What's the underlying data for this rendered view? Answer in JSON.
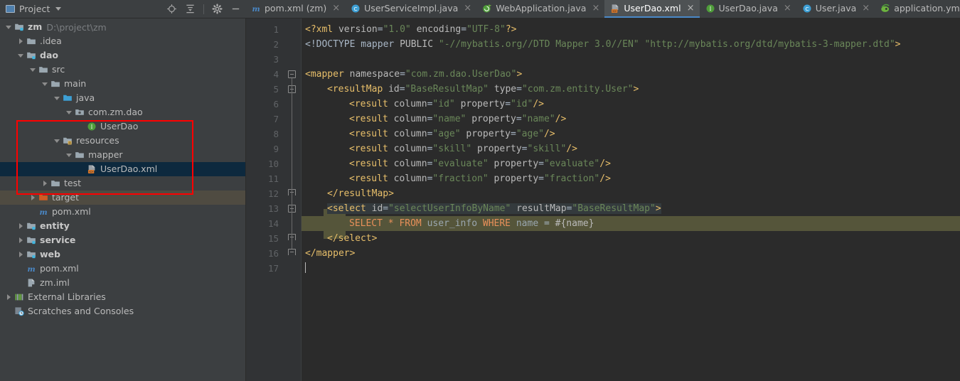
{
  "toolwindow": {
    "title": "Project",
    "dropdown_icon": "chevron-down-icon",
    "actions": [
      {
        "name": "locate-icon",
        "tooltip": "Select Opened File"
      },
      {
        "name": "collapse-all-icon",
        "tooltip": "Collapse All"
      },
      {
        "name": "gear-icon",
        "tooltip": "Settings"
      },
      {
        "name": "minimize-icon",
        "tooltip": "Hide"
      }
    ]
  },
  "tabs": [
    {
      "label": "pom.xml (zm)",
      "icon": "maven-icon",
      "active": false,
      "close": "×"
    },
    {
      "label": "UserServiceImpl.java",
      "icon": "java-class-icon",
      "active": false,
      "close": "×"
    },
    {
      "label": "WebApplication.java",
      "icon": "spring-boot-icon",
      "active": false,
      "close": "×"
    },
    {
      "label": "UserDao.xml",
      "icon": "mybatis-mapper-icon",
      "active": true,
      "close": "×"
    },
    {
      "label": "UserDao.java",
      "icon": "java-interface-icon",
      "active": false,
      "close": "×"
    },
    {
      "label": "User.java",
      "icon": "java-class-icon",
      "active": false,
      "close": "×"
    },
    {
      "label": "application.yml",
      "icon": "yaml-icon",
      "active": false,
      "close": "×"
    }
  ],
  "tree": [
    {
      "indent": 0,
      "arrow": "open",
      "icon": "module-folder-icon",
      "label": "zm",
      "bold": true,
      "path": "D:\\project\\zm",
      "state": "normal"
    },
    {
      "indent": 1,
      "arrow": "closed",
      "icon": "folder-icon",
      "label": ".idea",
      "bold": false,
      "path": "",
      "state": "normal"
    },
    {
      "indent": 1,
      "arrow": "open",
      "icon": "module-folder-icon",
      "label": "dao",
      "bold": true,
      "path": "",
      "state": "normal"
    },
    {
      "indent": 2,
      "arrow": "open",
      "icon": "folder-icon",
      "label": "src",
      "bold": false,
      "path": "",
      "state": "normal"
    },
    {
      "indent": 3,
      "arrow": "open",
      "icon": "folder-icon",
      "label": "main",
      "bold": false,
      "path": "",
      "state": "normal"
    },
    {
      "indent": 4,
      "arrow": "open",
      "icon": "source-root-icon",
      "label": "java",
      "bold": false,
      "path": "",
      "state": "normal"
    },
    {
      "indent": 5,
      "arrow": "open",
      "icon": "package-icon",
      "label": "com.zm.dao",
      "bold": false,
      "path": "",
      "state": "normal"
    },
    {
      "indent": 6,
      "arrow": "none",
      "icon": "interface-icon",
      "label": "UserDao",
      "bold": false,
      "path": "",
      "state": "normal"
    },
    {
      "indent": 4,
      "arrow": "open",
      "icon": "resources-root-icon",
      "label": "resources",
      "bold": false,
      "path": "",
      "state": "normal"
    },
    {
      "indent": 5,
      "arrow": "open",
      "icon": "folder-icon",
      "label": "mapper",
      "bold": false,
      "path": "",
      "state": "normal"
    },
    {
      "indent": 6,
      "arrow": "none",
      "icon": "mybatis-mapper-icon",
      "label": "UserDao.xml",
      "bold": false,
      "path": "",
      "state": "selected"
    },
    {
      "indent": 3,
      "arrow": "closed",
      "icon": "folder-icon",
      "label": "test",
      "bold": false,
      "path": "",
      "state": "normal"
    },
    {
      "indent": 2,
      "arrow": "closed",
      "icon": "excluded-folder-icon",
      "label": "target",
      "bold": false,
      "path": "",
      "state": "excluded"
    },
    {
      "indent": 2,
      "arrow": "none",
      "icon": "maven-icon",
      "label": "pom.xml",
      "bold": false,
      "path": "",
      "state": "normal"
    },
    {
      "indent": 1,
      "arrow": "closed",
      "icon": "module-folder-icon",
      "label": "entity",
      "bold": true,
      "path": "",
      "state": "normal"
    },
    {
      "indent": 1,
      "arrow": "closed",
      "icon": "module-folder-icon",
      "label": "service",
      "bold": true,
      "path": "",
      "state": "normal"
    },
    {
      "indent": 1,
      "arrow": "closed",
      "icon": "module-folder-icon",
      "label": "web",
      "bold": true,
      "path": "",
      "state": "normal"
    },
    {
      "indent": 1,
      "arrow": "none",
      "icon": "maven-icon",
      "label": "pom.xml",
      "bold": false,
      "path": "",
      "state": "normal"
    },
    {
      "indent": 1,
      "arrow": "none",
      "icon": "iml-icon",
      "label": "zm.iml",
      "bold": false,
      "path": "",
      "state": "normal"
    },
    {
      "indent": 0,
      "arrow": "closed",
      "icon": "libraries-icon",
      "label": "External Libraries",
      "bold": false,
      "path": "",
      "state": "normal"
    },
    {
      "indent": 0,
      "arrow": "none",
      "icon": "scratches-icon",
      "label": "Scratches and Consoles",
      "bold": false,
      "path": "",
      "state": "normal"
    }
  ],
  "annotation": {
    "shape": "rectangle",
    "color": "#ff0000",
    "covers": "com.zm.dao / UserDao / resources / mapper / UserDao.xml"
  },
  "editor": {
    "filename": "UserDao.xml",
    "line_numbers": [
      "1",
      "2",
      "3",
      "4",
      "5",
      "6",
      "7",
      "8",
      "9",
      "10",
      "11",
      "12",
      "13",
      "14",
      "15",
      "16",
      "17"
    ],
    "lines": [
      {
        "n": 1,
        "indent": 0,
        "tokens": [
          {
            "t": "<?xml ",
            "c": "t-pi"
          },
          {
            "t": "version",
            "c": "t-attr"
          },
          {
            "t": "=",
            "c": "t-plain"
          },
          {
            "t": "\"1.0\"",
            "c": "t-str"
          },
          {
            "t": " ",
            "c": "t-plain"
          },
          {
            "t": "encoding",
            "c": "t-attr"
          },
          {
            "t": "=",
            "c": "t-plain"
          },
          {
            "t": "\"UTF-8\"",
            "c": "t-str"
          },
          {
            "t": "?>",
            "c": "t-pi"
          }
        ]
      },
      {
        "n": 2,
        "indent": 0,
        "tokens": [
          {
            "t": "<!DOCTYPE ",
            "c": "t-doc"
          },
          {
            "t": "mapper ",
            "c": "t-doc"
          },
          {
            "t": "PUBLIC",
            "c": "t-attr"
          },
          {
            "t": " \"-//mybatis.org//DTD Mapper 3.0//EN\"",
            "c": "t-str"
          },
          {
            "t": " \"http://mybatis.org/dtd/mybatis-3-mapper.dtd\"",
            "c": "t-str"
          },
          {
            "t": ">",
            "c": "t-tag"
          }
        ]
      },
      {
        "n": 3,
        "indent": 0,
        "tokens": []
      },
      {
        "n": 4,
        "indent": 0,
        "tokens": [
          {
            "t": "<mapper ",
            "c": "t-tag"
          },
          {
            "t": "namespace",
            "c": "t-attr"
          },
          {
            "t": "=",
            "c": "t-plain"
          },
          {
            "t": "\"com.zm.dao.UserDao\"",
            "c": "t-str"
          },
          {
            "t": ">",
            "c": "t-tag"
          }
        ]
      },
      {
        "n": 5,
        "indent": 1,
        "tokens": [
          {
            "t": "<resultMap ",
            "c": "t-tag"
          },
          {
            "t": "id",
            "c": "t-attr"
          },
          {
            "t": "=",
            "c": "t-plain"
          },
          {
            "t": "\"BaseResultMap\"",
            "c": "t-str"
          },
          {
            "t": " ",
            "c": "t-plain"
          },
          {
            "t": "type",
            "c": "t-attr"
          },
          {
            "t": "=",
            "c": "t-plain"
          },
          {
            "t": "\"com.zm.entity.User\"",
            "c": "t-str"
          },
          {
            "t": ">",
            "c": "t-tag"
          }
        ]
      },
      {
        "n": 6,
        "indent": 2,
        "tokens": [
          {
            "t": "<result ",
            "c": "t-tag"
          },
          {
            "t": "column",
            "c": "t-attr"
          },
          {
            "t": "=",
            "c": "t-plain"
          },
          {
            "t": "\"id\"",
            "c": "t-str"
          },
          {
            "t": " ",
            "c": "t-plain"
          },
          {
            "t": "property",
            "c": "t-attr"
          },
          {
            "t": "=",
            "c": "t-plain"
          },
          {
            "t": "\"id\"",
            "c": "t-str"
          },
          {
            "t": "/>",
            "c": "t-tag"
          }
        ]
      },
      {
        "n": 7,
        "indent": 2,
        "tokens": [
          {
            "t": "<result ",
            "c": "t-tag"
          },
          {
            "t": "column",
            "c": "t-attr"
          },
          {
            "t": "=",
            "c": "t-plain"
          },
          {
            "t": "\"name\"",
            "c": "t-str"
          },
          {
            "t": " ",
            "c": "t-plain"
          },
          {
            "t": "property",
            "c": "t-attr"
          },
          {
            "t": "=",
            "c": "t-plain"
          },
          {
            "t": "\"name\"",
            "c": "t-str"
          },
          {
            "t": "/>",
            "c": "t-tag"
          }
        ]
      },
      {
        "n": 8,
        "indent": 2,
        "tokens": [
          {
            "t": "<result ",
            "c": "t-tag"
          },
          {
            "t": "column",
            "c": "t-attr"
          },
          {
            "t": "=",
            "c": "t-plain"
          },
          {
            "t": "\"age\"",
            "c": "t-str"
          },
          {
            "t": " ",
            "c": "t-plain"
          },
          {
            "t": "property",
            "c": "t-attr"
          },
          {
            "t": "=",
            "c": "t-plain"
          },
          {
            "t": "\"age\"",
            "c": "t-str"
          },
          {
            "t": "/>",
            "c": "t-tag"
          }
        ]
      },
      {
        "n": 9,
        "indent": 2,
        "tokens": [
          {
            "t": "<result ",
            "c": "t-tag"
          },
          {
            "t": "column",
            "c": "t-attr"
          },
          {
            "t": "=",
            "c": "t-plain"
          },
          {
            "t": "\"skill\"",
            "c": "t-str"
          },
          {
            "t": " ",
            "c": "t-plain"
          },
          {
            "t": "property",
            "c": "t-attr"
          },
          {
            "t": "=",
            "c": "t-plain"
          },
          {
            "t": "\"skill\"",
            "c": "t-str"
          },
          {
            "t": "/>",
            "c": "t-tag"
          }
        ]
      },
      {
        "n": 10,
        "indent": 2,
        "tokens": [
          {
            "t": "<result ",
            "c": "t-tag"
          },
          {
            "t": "column",
            "c": "t-attr"
          },
          {
            "t": "=",
            "c": "t-plain"
          },
          {
            "t": "\"evaluate\"",
            "c": "t-str"
          },
          {
            "t": " ",
            "c": "t-plain"
          },
          {
            "t": "property",
            "c": "t-attr"
          },
          {
            "t": "=",
            "c": "t-plain"
          },
          {
            "t": "\"evaluate\"",
            "c": "t-str"
          },
          {
            "t": "/>",
            "c": "t-tag"
          }
        ]
      },
      {
        "n": 11,
        "indent": 2,
        "tokens": [
          {
            "t": "<result ",
            "c": "t-tag"
          },
          {
            "t": "column",
            "c": "t-attr"
          },
          {
            "t": "=",
            "c": "t-plain"
          },
          {
            "t": "\"fraction\"",
            "c": "t-str"
          },
          {
            "t": " ",
            "c": "t-plain"
          },
          {
            "t": "property",
            "c": "t-attr"
          },
          {
            "t": "=",
            "c": "t-plain"
          },
          {
            "t": "\"fraction\"",
            "c": "t-str"
          },
          {
            "t": "/>",
            "c": "t-tag"
          }
        ]
      },
      {
        "n": 12,
        "indent": 1,
        "tokens": [
          {
            "t": "</resultMap>",
            "c": "t-tag"
          }
        ]
      },
      {
        "n": 13,
        "indent": 1,
        "tokens": [
          {
            "t": "<select ",
            "c": "t-tag"
          },
          {
            "t": "id",
            "c": "t-attr"
          },
          {
            "t": "=",
            "c": "t-plain"
          },
          {
            "t": "\"selectUserInfoByName\"",
            "c": "t-str"
          },
          {
            "t": " ",
            "c": "t-plain"
          },
          {
            "t": "resultMap",
            "c": "t-attr"
          },
          {
            "t": "=",
            "c": "t-plain"
          },
          {
            "t": "\"BaseResultMap\"",
            "c": "t-str"
          },
          {
            "t": ">",
            "c": "t-tag"
          }
        ]
      },
      {
        "n": 14,
        "indent": 2,
        "tokens": [
          {
            "t": "SELECT",
            "c": "t-sqlkw"
          },
          {
            "t": " ",
            "c": "t-plain"
          },
          {
            "t": "*",
            "c": "t-sqlkw"
          },
          {
            "t": " ",
            "c": "t-plain"
          },
          {
            "t": "FROM",
            "c": "t-sqlkw"
          },
          {
            "t": " ",
            "c": "t-plain"
          },
          {
            "t": "user_info",
            "c": "t-sqltbl"
          },
          {
            "t": " ",
            "c": "t-plain"
          },
          {
            "t": "WHERE",
            "c": "t-sqlkw"
          },
          {
            "t": " ",
            "c": "t-plain"
          },
          {
            "t": "name",
            "c": "t-sqltbl"
          },
          {
            "t": " = ",
            "c": "t-plain"
          },
          {
            "t": "#{name}",
            "c": "t-param"
          }
        ]
      },
      {
        "n": 15,
        "indent": 1,
        "tokens": [
          {
            "t": "</select>",
            "c": "t-tag"
          }
        ]
      },
      {
        "n": 16,
        "indent": 0,
        "tokens": [
          {
            "t": "</mapper>",
            "c": "t-tag"
          }
        ]
      },
      {
        "n": 17,
        "indent": 0,
        "tokens": []
      }
    ],
    "caret_line": 17,
    "sql_highlight_lines": [
      13,
      14,
      15
    ],
    "colors": {
      "background": "#2b2b2b",
      "gutter": "#313335",
      "sql_injection_highlight": "#55553a",
      "selection": "#343a3d",
      "tag": "#e8bf6a",
      "attribute": "#bababa",
      "string": "#6a8759",
      "sql_keyword": "#e8905a",
      "tab_active_underline": "#4a88c7",
      "tree_selection": "#0d293e",
      "excluded_row": "#4f4b41",
      "annotation": "#ff0000"
    }
  }
}
